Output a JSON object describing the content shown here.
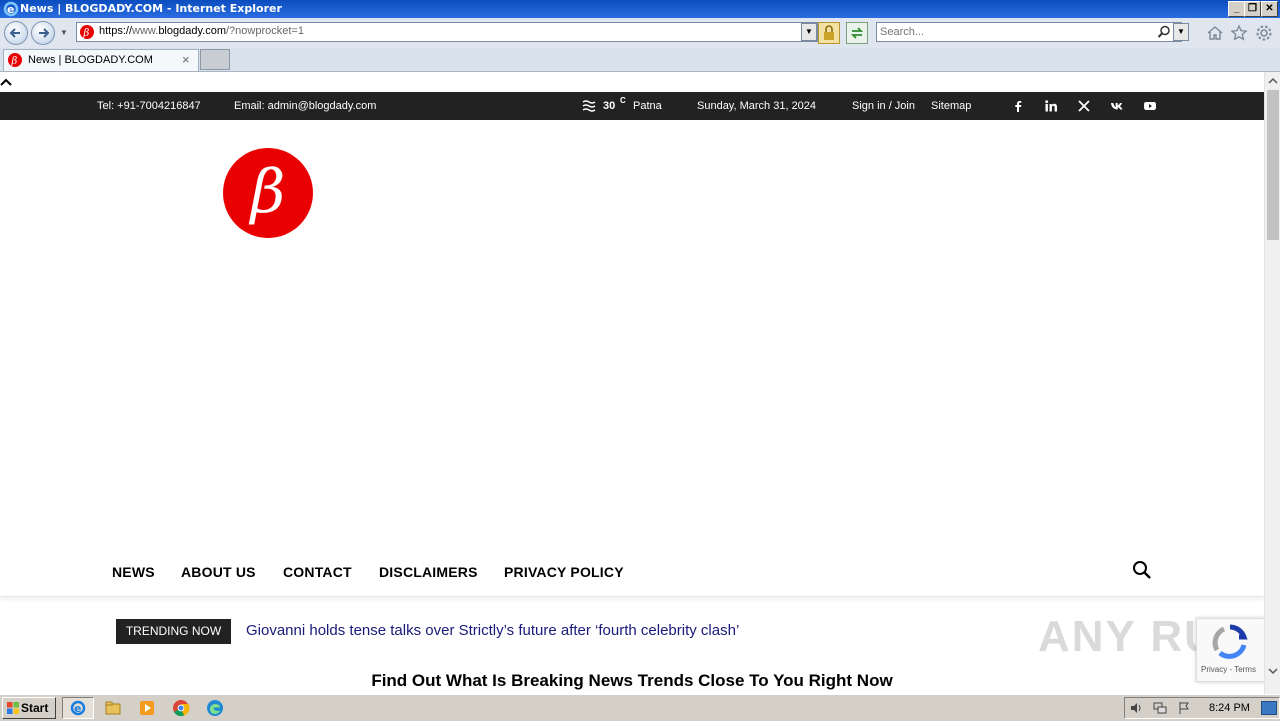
{
  "window": {
    "title": "News | BLOGDADY.COM - Internet Explorer",
    "controls": [
      "minimize",
      "restore",
      "close"
    ]
  },
  "addressbar": {
    "url_scheme": "https://",
    "url_host_prefix": "www.",
    "url_host": "blogdady.com",
    "url_path": "/?nowprocket=1",
    "search_placeholder": "Search..."
  },
  "tabs": [
    {
      "title": "News | BLOGDADY.COM"
    }
  ],
  "site": {
    "topbar": {
      "tel": "Tel: +91-7004216847",
      "email": "Email: admin@blogdady.com",
      "temp": "30",
      "temp_unit": "C",
      "city": "Patna",
      "date": "Sunday, March 31, 2024",
      "signin": "Sign in / Join",
      "sitemap": "Sitemap",
      "social_icons": [
        "facebook-icon",
        "linkedin-icon",
        "x-icon",
        "vk-icon",
        "youtube-icon"
      ]
    },
    "logo_letter": "β",
    "menu": [
      "NEWS",
      "ABOUT US",
      "CONTACT",
      "DISCLAIMERS",
      "PRIVACY POLICY"
    ],
    "trending_label": "TRENDING NOW",
    "trending_text": "Giovanni holds tense talks over Strictly’s future after ‘fourth celebrity clash’",
    "headline": "Find Out What Is Breaking News Trends Close To You Right Now",
    "recaptcha_text": "Privacy - Terms",
    "watermark": "ANY RUN"
  },
  "taskbar": {
    "start_label": "Start",
    "clock": "8:24 PM"
  },
  "colors": {
    "brand_red": "#e90000",
    "topbar_bg": "#222222",
    "trending_text": "#1a1a7a"
  }
}
